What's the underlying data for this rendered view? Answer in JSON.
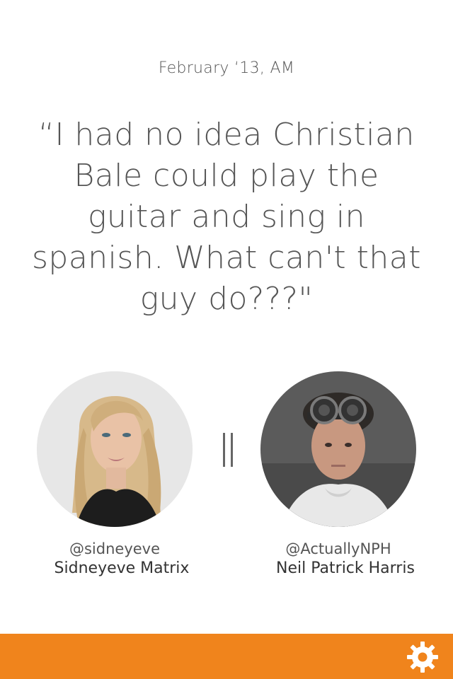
{
  "post": {
    "date": "February ‘13, AM",
    "quote": "“I had no idea Christian Bale could play the guitar and sing in spanish. What can't that guy do???\""
  },
  "people": {
    "left": {
      "handle": "@sidneyeve",
      "name": "Sidneyeve Matrix"
    },
    "right": {
      "handle": "@ActuallyNPH",
      "name": "Neil Patrick Harris"
    }
  },
  "footer": {
    "color": "#f0841c",
    "icon": "gear-icon"
  }
}
